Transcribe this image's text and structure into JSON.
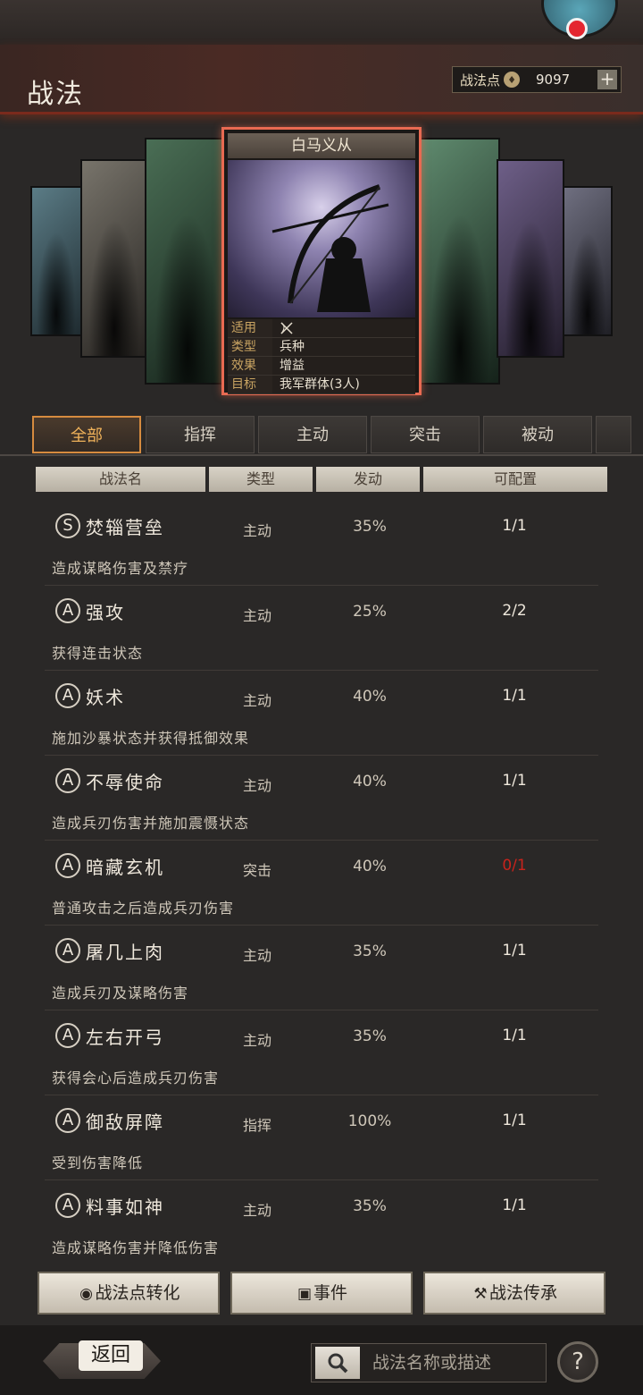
{
  "header": {
    "title": "战法",
    "points_label": "战法点",
    "points_value": "9097",
    "plus_label": "+"
  },
  "featured_card": {
    "title": "白马义从",
    "rows": [
      {
        "key": "适用",
        "value": ""
      },
      {
        "key": "类型",
        "value": "兵种"
      },
      {
        "key": "效果",
        "value": "增益"
      },
      {
        "key": "目标",
        "value": "我军群体(3人)"
      }
    ]
  },
  "tabs": [
    "全部",
    "指挥",
    "主动",
    "突击",
    "被动"
  ],
  "active_tab": "全部",
  "columns": [
    "战法名",
    "类型",
    "发动",
    "可配置"
  ],
  "skills": [
    {
      "grade": "S",
      "name": "焚辎营垒",
      "type": "主动",
      "rate": "35%",
      "count": "1/1",
      "desc": "造成谋略伤害及禁疗"
    },
    {
      "grade": "A",
      "name": "强攻",
      "type": "主动",
      "rate": "25%",
      "count": "2/2",
      "desc": "获得连击状态"
    },
    {
      "grade": "A",
      "name": "妖术",
      "type": "主动",
      "rate": "40%",
      "count": "1/1",
      "desc": "施加沙暴状态并获得抵御效果"
    },
    {
      "grade": "A",
      "name": "不辱使命",
      "type": "主动",
      "rate": "40%",
      "count": "1/1",
      "desc": "造成兵刃伤害并施加震慑状态"
    },
    {
      "grade": "A",
      "name": "暗藏玄机",
      "type": "突击",
      "rate": "40%",
      "count": "0/1",
      "desc": "普通攻击之后造成兵刃伤害"
    },
    {
      "grade": "A",
      "name": "屠几上肉",
      "type": "主动",
      "rate": "35%",
      "count": "1/1",
      "desc": "造成兵刃及谋略伤害"
    },
    {
      "grade": "A",
      "name": "左右开弓",
      "type": "主动",
      "rate": "35%",
      "count": "1/1",
      "desc": "获得会心后造成兵刃伤害"
    },
    {
      "grade": "A",
      "name": "御敌屏障",
      "type": "指挥",
      "rate": "100%",
      "count": "1/1",
      "desc": "受到伤害降低"
    },
    {
      "grade": "A",
      "name": "料事如神",
      "type": "主动",
      "rate": "35%",
      "count": "1/1",
      "desc": "造成谋略伤害并降低伤害"
    }
  ],
  "buttons": {
    "convert": "战法点转化",
    "events": "事件",
    "inherit": "战法传承"
  },
  "footer": {
    "back": "返回",
    "search_placeholder": "战法名称或描述",
    "help": "?"
  },
  "colors": {
    "accent": "#d68b3f",
    "card_border": "#e86a52",
    "zero_count": "#c8231c"
  }
}
